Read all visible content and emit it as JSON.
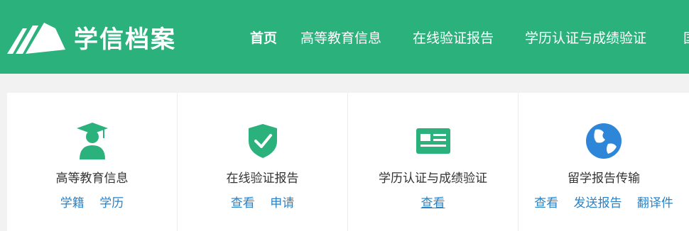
{
  "header": {
    "logo_text": "学信档案",
    "nav": [
      {
        "label": "首页",
        "active": true
      },
      {
        "label": "高等教育信息",
        "active": false
      },
      {
        "label": "在线验证报告",
        "active": false
      },
      {
        "label": "学历认证与成绩验证",
        "active": false
      },
      {
        "label": "国",
        "active": false
      }
    ]
  },
  "services": [
    {
      "title": "高等教育信息",
      "icon": "graduate-user-icon",
      "links": [
        "学籍",
        "学历"
      ]
    },
    {
      "title": "在线验证报告",
      "icon": "shield-check-icon",
      "links": [
        "查看",
        "申请"
      ]
    },
    {
      "title": "学历认证与成绩验证",
      "icon": "id-card-icon",
      "links": [
        "查看"
      ]
    },
    {
      "title": "留学报告传输",
      "icon": "globe-icon",
      "links": [
        "查看",
        "发送报告",
        "翻译件"
      ]
    }
  ],
  "colors": {
    "brand_green": "#2bb27c",
    "link_blue": "#2b82c5",
    "globe_blue": "#2d86d8"
  }
}
